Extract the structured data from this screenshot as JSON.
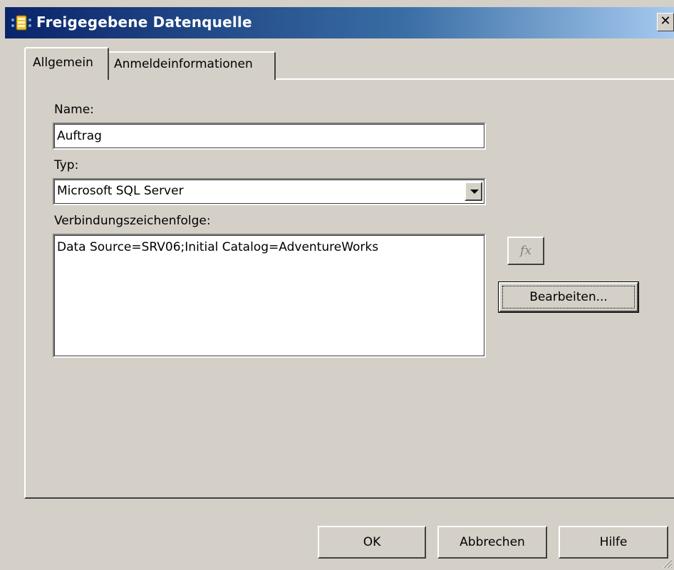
{
  "window": {
    "title": "Freigegebene Datenquelle",
    "close_icon": "close-icon"
  },
  "tabs": [
    {
      "label": "Allgemein",
      "active": true
    },
    {
      "label": "Anmeldeinformationen",
      "active": false
    }
  ],
  "form": {
    "name_label": "Name:",
    "name_value": "Auftrag",
    "type_label": "Typ:",
    "type_value": "Microsoft SQL Server",
    "conn_label": "Verbindungszeichenfolge:",
    "conn_value": "Data Source=SRV06;Initial Catalog=AdventureWorks",
    "fx_label": "fx",
    "edit_button": "Bearbeiten..."
  },
  "footer": {
    "ok": "OK",
    "cancel": "Abbrechen",
    "help": "Hilfe"
  },
  "colors": {
    "title_bar_start": "#0a246a",
    "title_bar_end": "#a6caf0",
    "dialog_bg": "#d4d0c8"
  }
}
